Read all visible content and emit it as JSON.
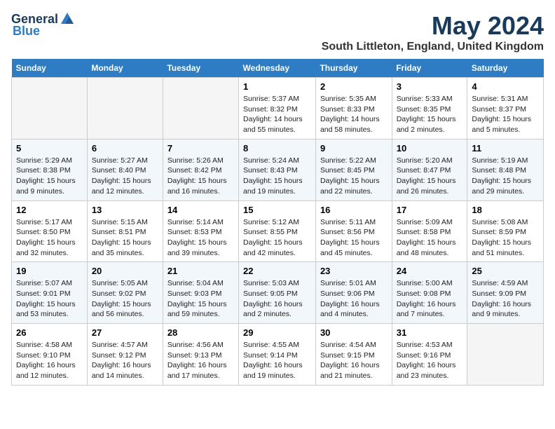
{
  "header": {
    "logo_general": "General",
    "logo_blue": "Blue",
    "month_year": "May 2024",
    "location": "South Littleton, England, United Kingdom"
  },
  "weekdays": [
    "Sunday",
    "Monday",
    "Tuesday",
    "Wednesday",
    "Thursday",
    "Friday",
    "Saturday"
  ],
  "weeks": [
    [
      {
        "day": "",
        "empty": true
      },
      {
        "day": "",
        "empty": true
      },
      {
        "day": "",
        "empty": true
      },
      {
        "day": "1",
        "sunrise": "Sunrise: 5:37 AM",
        "sunset": "Sunset: 8:32 PM",
        "daylight": "Daylight: 14 hours and 55 minutes."
      },
      {
        "day": "2",
        "sunrise": "Sunrise: 5:35 AM",
        "sunset": "Sunset: 8:33 PM",
        "daylight": "Daylight: 14 hours and 58 minutes."
      },
      {
        "day": "3",
        "sunrise": "Sunrise: 5:33 AM",
        "sunset": "Sunset: 8:35 PM",
        "daylight": "Daylight: 15 hours and 2 minutes."
      },
      {
        "day": "4",
        "sunrise": "Sunrise: 5:31 AM",
        "sunset": "Sunset: 8:37 PM",
        "daylight": "Daylight: 15 hours and 5 minutes."
      }
    ],
    [
      {
        "day": "5",
        "sunrise": "Sunrise: 5:29 AM",
        "sunset": "Sunset: 8:38 PM",
        "daylight": "Daylight: 15 hours and 9 minutes."
      },
      {
        "day": "6",
        "sunrise": "Sunrise: 5:27 AM",
        "sunset": "Sunset: 8:40 PM",
        "daylight": "Daylight: 15 hours and 12 minutes."
      },
      {
        "day": "7",
        "sunrise": "Sunrise: 5:26 AM",
        "sunset": "Sunset: 8:42 PM",
        "daylight": "Daylight: 15 hours and 16 minutes."
      },
      {
        "day": "8",
        "sunrise": "Sunrise: 5:24 AM",
        "sunset": "Sunset: 8:43 PM",
        "daylight": "Daylight: 15 hours and 19 minutes."
      },
      {
        "day": "9",
        "sunrise": "Sunrise: 5:22 AM",
        "sunset": "Sunset: 8:45 PM",
        "daylight": "Daylight: 15 hours and 22 minutes."
      },
      {
        "day": "10",
        "sunrise": "Sunrise: 5:20 AM",
        "sunset": "Sunset: 8:47 PM",
        "daylight": "Daylight: 15 hours and 26 minutes."
      },
      {
        "day": "11",
        "sunrise": "Sunrise: 5:19 AM",
        "sunset": "Sunset: 8:48 PM",
        "daylight": "Daylight: 15 hours and 29 minutes."
      }
    ],
    [
      {
        "day": "12",
        "sunrise": "Sunrise: 5:17 AM",
        "sunset": "Sunset: 8:50 PM",
        "daylight": "Daylight: 15 hours and 32 minutes."
      },
      {
        "day": "13",
        "sunrise": "Sunrise: 5:15 AM",
        "sunset": "Sunset: 8:51 PM",
        "daylight": "Daylight: 15 hours and 35 minutes."
      },
      {
        "day": "14",
        "sunrise": "Sunrise: 5:14 AM",
        "sunset": "Sunset: 8:53 PM",
        "daylight": "Daylight: 15 hours and 39 minutes."
      },
      {
        "day": "15",
        "sunrise": "Sunrise: 5:12 AM",
        "sunset": "Sunset: 8:55 PM",
        "daylight": "Daylight: 15 hours and 42 minutes."
      },
      {
        "day": "16",
        "sunrise": "Sunrise: 5:11 AM",
        "sunset": "Sunset: 8:56 PM",
        "daylight": "Daylight: 15 hours and 45 minutes."
      },
      {
        "day": "17",
        "sunrise": "Sunrise: 5:09 AM",
        "sunset": "Sunset: 8:58 PM",
        "daylight": "Daylight: 15 hours and 48 minutes."
      },
      {
        "day": "18",
        "sunrise": "Sunrise: 5:08 AM",
        "sunset": "Sunset: 8:59 PM",
        "daylight": "Daylight: 15 hours and 51 minutes."
      }
    ],
    [
      {
        "day": "19",
        "sunrise": "Sunrise: 5:07 AM",
        "sunset": "Sunset: 9:01 PM",
        "daylight": "Daylight: 15 hours and 53 minutes."
      },
      {
        "day": "20",
        "sunrise": "Sunrise: 5:05 AM",
        "sunset": "Sunset: 9:02 PM",
        "daylight": "Daylight: 15 hours and 56 minutes."
      },
      {
        "day": "21",
        "sunrise": "Sunrise: 5:04 AM",
        "sunset": "Sunset: 9:03 PM",
        "daylight": "Daylight: 15 hours and 59 minutes."
      },
      {
        "day": "22",
        "sunrise": "Sunrise: 5:03 AM",
        "sunset": "Sunset: 9:05 PM",
        "daylight": "Daylight: 16 hours and 2 minutes."
      },
      {
        "day": "23",
        "sunrise": "Sunrise: 5:01 AM",
        "sunset": "Sunset: 9:06 PM",
        "daylight": "Daylight: 16 hours and 4 minutes."
      },
      {
        "day": "24",
        "sunrise": "Sunrise: 5:00 AM",
        "sunset": "Sunset: 9:08 PM",
        "daylight": "Daylight: 16 hours and 7 minutes."
      },
      {
        "day": "25",
        "sunrise": "Sunrise: 4:59 AM",
        "sunset": "Sunset: 9:09 PM",
        "daylight": "Daylight: 16 hours and 9 minutes."
      }
    ],
    [
      {
        "day": "26",
        "sunrise": "Sunrise: 4:58 AM",
        "sunset": "Sunset: 9:10 PM",
        "daylight": "Daylight: 16 hours and 12 minutes."
      },
      {
        "day": "27",
        "sunrise": "Sunrise: 4:57 AM",
        "sunset": "Sunset: 9:12 PM",
        "daylight": "Daylight: 16 hours and 14 minutes."
      },
      {
        "day": "28",
        "sunrise": "Sunrise: 4:56 AM",
        "sunset": "Sunset: 9:13 PM",
        "daylight": "Daylight: 16 hours and 17 minutes."
      },
      {
        "day": "29",
        "sunrise": "Sunrise: 4:55 AM",
        "sunset": "Sunset: 9:14 PM",
        "daylight": "Daylight: 16 hours and 19 minutes."
      },
      {
        "day": "30",
        "sunrise": "Sunrise: 4:54 AM",
        "sunset": "Sunset: 9:15 PM",
        "daylight": "Daylight: 16 hours and 21 minutes."
      },
      {
        "day": "31",
        "sunrise": "Sunrise: 4:53 AM",
        "sunset": "Sunset: 9:16 PM",
        "daylight": "Daylight: 16 hours and 23 minutes."
      },
      {
        "day": "",
        "empty": true
      }
    ]
  ]
}
